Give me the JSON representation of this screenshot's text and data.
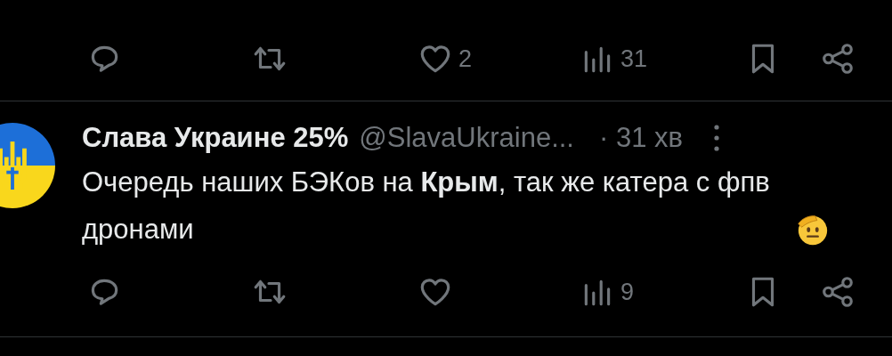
{
  "previous_tweet": {
    "actions": {
      "like": "2",
      "views": "31"
    }
  },
  "tweet": {
    "author": "Слава Украине 25%",
    "handle": "@SlavaUkraine...",
    "time": "· 31 хв",
    "text": "Очередь наших БЭКов на **Крым**, так же катера с фпв дронами",
    "actions": {
      "views": "9"
    }
  }
}
